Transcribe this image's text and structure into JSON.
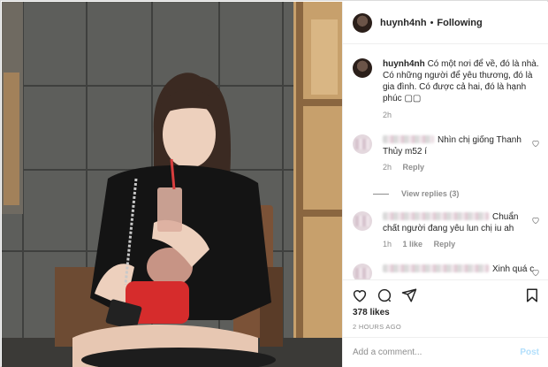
{
  "header": {
    "username": "huynh4nh",
    "separator": "•",
    "follow_label": "Following"
  },
  "caption": {
    "username": "huynh4nh",
    "text": "Có một nơi để về, đó là nhà. Có những người để yêu thương, đó là gia đình. Có được cả hai, đó là hạnh phúc",
    "emoji": "▢▢",
    "time": "2h"
  },
  "comments": [
    {
      "text": "Nhìn chị giống Thanh Thủy m52 í",
      "time": "2h",
      "reply_label": "Reply",
      "likes": ""
    },
    {
      "text": "Chuẩn chất người đang yêu lun chị iu ah",
      "time": "1h",
      "reply_label": "Reply",
      "likes": "1 like"
    },
    {
      "text": "Xinh quá c",
      "time": "",
      "reply_label": "",
      "likes": ""
    }
  ],
  "view_replies_label": "View replies (3)",
  "icons": {
    "like": "heart-icon",
    "comment": "comment-bubble-icon",
    "share": "paper-plane-icon",
    "save": "bookmark-icon"
  },
  "likes_text": "378 likes",
  "time_ago": "2 HOURS AGO",
  "add_comment": {
    "placeholder": "Add a comment...",
    "post_label": "Post"
  },
  "colors": {
    "post_disabled": "#b2dffc",
    "muted": "#8e8e8e",
    "text": "#262626"
  }
}
